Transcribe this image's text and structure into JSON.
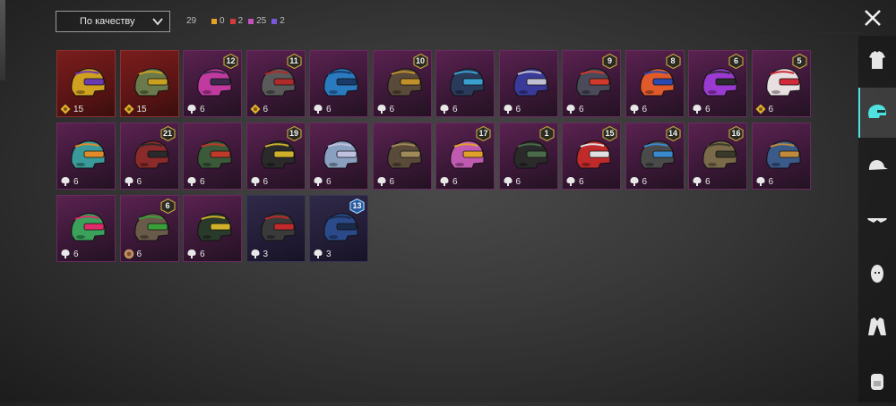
{
  "toolbar": {
    "sort_label": "По качеству",
    "total": "29",
    "counts": [
      {
        "value": "0",
        "color": "#e6a224"
      },
      {
        "value": "2",
        "color": "#d63a3a"
      },
      {
        "value": "25",
        "color": "#c84fc0"
      },
      {
        "value": "2",
        "color": "#7a55e0"
      }
    ]
  },
  "sidebar": {
    "tabs": [
      {
        "name": "tab-outfit",
        "icon": "shirt-icon",
        "active": false
      },
      {
        "name": "tab-helmet",
        "icon": "helmet-icon",
        "active": true
      },
      {
        "name": "tab-hat",
        "icon": "cap-icon",
        "active": false
      },
      {
        "name": "tab-glasses",
        "icon": "glasses-icon",
        "active": false
      },
      {
        "name": "tab-face",
        "icon": "face-icon",
        "active": false
      },
      {
        "name": "tab-jacket",
        "icon": "jacket-icon",
        "active": false
      },
      {
        "name": "tab-backpack",
        "icon": "backpack-icon",
        "active": false
      }
    ]
  },
  "items": [
    {
      "quality": "red",
      "value": "15",
      "currency": "gold",
      "badge": null,
      "color": "#d0a020",
      "accent": "#6a3ab0"
    },
    {
      "quality": "red",
      "value": "15",
      "currency": "gold",
      "badge": null,
      "color": "#6b7a4a",
      "accent": "#c8a020"
    },
    {
      "quality": "purple",
      "value": "6",
      "currency": "silver",
      "badge": "12",
      "color": "#c03aa0",
      "accent": "#3a2a4a"
    },
    {
      "quality": "purple",
      "value": "6",
      "currency": "gold",
      "badge": "11",
      "color": "#5a5a5a",
      "accent": "#b02a2a"
    },
    {
      "quality": "purple",
      "value": "6",
      "currency": "silver",
      "badge": null,
      "color": "#2a7ac0",
      "accent": "#1a3a6a"
    },
    {
      "quality": "purple",
      "value": "6",
      "currency": "silver",
      "badge": "10",
      "color": "#5a4a3a",
      "accent": "#c0902a"
    },
    {
      "quality": "purple",
      "value": "6",
      "currency": "silver",
      "badge": null,
      "color": "#2a3a5a",
      "accent": "#3aa0d0"
    },
    {
      "quality": "purple",
      "value": "6",
      "currency": "silver",
      "badge": null,
      "color": "#3a3a9a",
      "accent": "#c0c0d0"
    },
    {
      "quality": "purple",
      "value": "6",
      "currency": "silver",
      "badge": "9",
      "color": "#4a4a5a",
      "accent": "#d03a2a"
    },
    {
      "quality": "purple",
      "value": "6",
      "currency": "silver",
      "badge": "8",
      "color": "#e05a2a",
      "accent": "#2a4ab0"
    },
    {
      "quality": "purple",
      "value": "6",
      "currency": "silver",
      "badge": "6",
      "color": "#9a3ad0",
      "accent": "#2a2a2a"
    },
    {
      "quality": "purple",
      "value": "6",
      "currency": "gold",
      "badge": "5",
      "color": "#e8e0e0",
      "accent": "#d02a3a"
    },
    {
      "quality": "purple",
      "value": "6",
      "currency": "silver",
      "badge": null,
      "color": "#3a9a9a",
      "accent": "#e08a2a"
    },
    {
      "quality": "purple",
      "value": "6",
      "currency": "silver",
      "badge": "21",
      "color": "#8a2a2a",
      "accent": "#2a2a2a"
    },
    {
      "quality": "purple",
      "value": "6",
      "currency": "silver",
      "badge": null,
      "color": "#3a5a3a",
      "accent": "#c03a2a"
    },
    {
      "quality": "purple",
      "value": "6",
      "currency": "silver",
      "badge": "19",
      "color": "#2a2a2a",
      "accent": "#d0b02a"
    },
    {
      "quality": "purple",
      "value": "6",
      "currency": "silver",
      "badge": null,
      "color": "#8aa0c0",
      "accent": "#c0c0e0"
    },
    {
      "quality": "purple",
      "value": "6",
      "currency": "silver",
      "badge": null,
      "color": "#5a4a3a",
      "accent": "#a08a5a"
    },
    {
      "quality": "purple",
      "value": "6",
      "currency": "silver",
      "badge": "17",
      "color": "#c05ab0",
      "accent": "#e0a02a"
    },
    {
      "quality": "purple",
      "value": "6",
      "currency": "silver",
      "badge": "1",
      "color": "#2a2a2a",
      "accent": "#4a6a4a"
    },
    {
      "quality": "purple",
      "value": "6",
      "currency": "silver",
      "badge": "15",
      "color": "#c02a2a",
      "accent": "#e0e0e0"
    },
    {
      "quality": "purple",
      "value": "6",
      "currency": "silver",
      "badge": "14",
      "color": "#4a4a4a",
      "accent": "#3a8ad0"
    },
    {
      "quality": "purple",
      "value": "6",
      "currency": "silver",
      "badge": "16",
      "color": "#7a6a4a",
      "accent": "#3a3a2a"
    },
    {
      "quality": "purple",
      "value": "6",
      "currency": "silver",
      "badge": null,
      "color": "#3a5a8a",
      "accent": "#c08a3a"
    },
    {
      "quality": "purple",
      "value": "6",
      "currency": "silver",
      "badge": null,
      "color": "#3aa05a",
      "accent": "#e02a6a"
    },
    {
      "quality": "purple",
      "value": "6",
      "currency": "bronze",
      "badge": "6",
      "color": "#6a5a4a",
      "accent": "#3aa03a"
    },
    {
      "quality": "purple",
      "value": "6",
      "currency": "silver",
      "badge": null,
      "color": "#2a3a2a",
      "accent": "#d0b02a"
    },
    {
      "quality": "dark",
      "value": "3",
      "currency": "silver",
      "badge": null,
      "color": "#3a3a3a",
      "accent": "#c02a2a"
    },
    {
      "quality": "dark",
      "value": "3",
      "currency": "silver",
      "badge": "13",
      "badge_style": "blue",
      "color": "#2a4a8a",
      "accent": "#1a2a4a"
    }
  ]
}
